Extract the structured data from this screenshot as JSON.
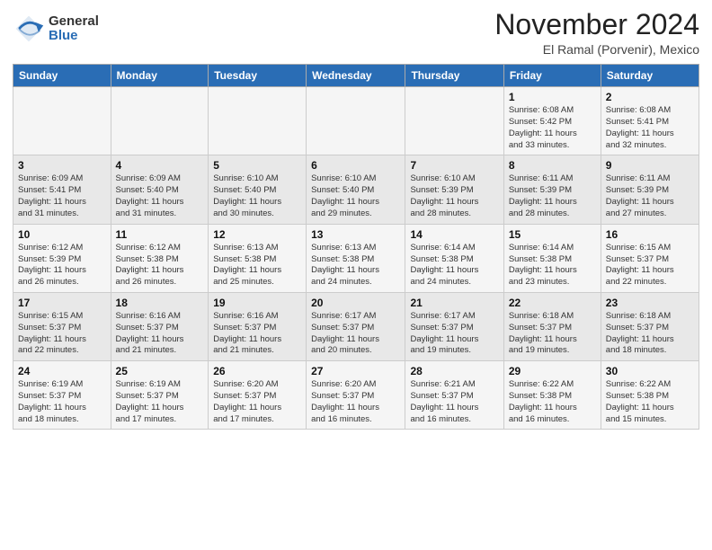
{
  "header": {
    "logo_general": "General",
    "logo_blue": "Blue",
    "month_year": "November 2024",
    "location": "El Ramal (Porvenir), Mexico"
  },
  "days_of_week": [
    "Sunday",
    "Monday",
    "Tuesday",
    "Wednesday",
    "Thursday",
    "Friday",
    "Saturday"
  ],
  "weeks": [
    [
      {
        "day": "",
        "info": ""
      },
      {
        "day": "",
        "info": ""
      },
      {
        "day": "",
        "info": ""
      },
      {
        "day": "",
        "info": ""
      },
      {
        "day": "",
        "info": ""
      },
      {
        "day": "1",
        "info": "Sunrise: 6:08 AM\nSunset: 5:42 PM\nDaylight: 11 hours\nand 33 minutes."
      },
      {
        "day": "2",
        "info": "Sunrise: 6:08 AM\nSunset: 5:41 PM\nDaylight: 11 hours\nand 32 minutes."
      }
    ],
    [
      {
        "day": "3",
        "info": "Sunrise: 6:09 AM\nSunset: 5:41 PM\nDaylight: 11 hours\nand 31 minutes."
      },
      {
        "day": "4",
        "info": "Sunrise: 6:09 AM\nSunset: 5:40 PM\nDaylight: 11 hours\nand 31 minutes."
      },
      {
        "day": "5",
        "info": "Sunrise: 6:10 AM\nSunset: 5:40 PM\nDaylight: 11 hours\nand 30 minutes."
      },
      {
        "day": "6",
        "info": "Sunrise: 6:10 AM\nSunset: 5:40 PM\nDaylight: 11 hours\nand 29 minutes."
      },
      {
        "day": "7",
        "info": "Sunrise: 6:10 AM\nSunset: 5:39 PM\nDaylight: 11 hours\nand 28 minutes."
      },
      {
        "day": "8",
        "info": "Sunrise: 6:11 AM\nSunset: 5:39 PM\nDaylight: 11 hours\nand 28 minutes."
      },
      {
        "day": "9",
        "info": "Sunrise: 6:11 AM\nSunset: 5:39 PM\nDaylight: 11 hours\nand 27 minutes."
      }
    ],
    [
      {
        "day": "10",
        "info": "Sunrise: 6:12 AM\nSunset: 5:39 PM\nDaylight: 11 hours\nand 26 minutes."
      },
      {
        "day": "11",
        "info": "Sunrise: 6:12 AM\nSunset: 5:38 PM\nDaylight: 11 hours\nand 26 minutes."
      },
      {
        "day": "12",
        "info": "Sunrise: 6:13 AM\nSunset: 5:38 PM\nDaylight: 11 hours\nand 25 minutes."
      },
      {
        "day": "13",
        "info": "Sunrise: 6:13 AM\nSunset: 5:38 PM\nDaylight: 11 hours\nand 24 minutes."
      },
      {
        "day": "14",
        "info": "Sunrise: 6:14 AM\nSunset: 5:38 PM\nDaylight: 11 hours\nand 24 minutes."
      },
      {
        "day": "15",
        "info": "Sunrise: 6:14 AM\nSunset: 5:38 PM\nDaylight: 11 hours\nand 23 minutes."
      },
      {
        "day": "16",
        "info": "Sunrise: 6:15 AM\nSunset: 5:37 PM\nDaylight: 11 hours\nand 22 minutes."
      }
    ],
    [
      {
        "day": "17",
        "info": "Sunrise: 6:15 AM\nSunset: 5:37 PM\nDaylight: 11 hours\nand 22 minutes."
      },
      {
        "day": "18",
        "info": "Sunrise: 6:16 AM\nSunset: 5:37 PM\nDaylight: 11 hours\nand 21 minutes."
      },
      {
        "day": "19",
        "info": "Sunrise: 6:16 AM\nSunset: 5:37 PM\nDaylight: 11 hours\nand 21 minutes."
      },
      {
        "day": "20",
        "info": "Sunrise: 6:17 AM\nSunset: 5:37 PM\nDaylight: 11 hours\nand 20 minutes."
      },
      {
        "day": "21",
        "info": "Sunrise: 6:17 AM\nSunset: 5:37 PM\nDaylight: 11 hours\nand 19 minutes."
      },
      {
        "day": "22",
        "info": "Sunrise: 6:18 AM\nSunset: 5:37 PM\nDaylight: 11 hours\nand 19 minutes."
      },
      {
        "day": "23",
        "info": "Sunrise: 6:18 AM\nSunset: 5:37 PM\nDaylight: 11 hours\nand 18 minutes."
      }
    ],
    [
      {
        "day": "24",
        "info": "Sunrise: 6:19 AM\nSunset: 5:37 PM\nDaylight: 11 hours\nand 18 minutes."
      },
      {
        "day": "25",
        "info": "Sunrise: 6:19 AM\nSunset: 5:37 PM\nDaylight: 11 hours\nand 17 minutes."
      },
      {
        "day": "26",
        "info": "Sunrise: 6:20 AM\nSunset: 5:37 PM\nDaylight: 11 hours\nand 17 minutes."
      },
      {
        "day": "27",
        "info": "Sunrise: 6:20 AM\nSunset: 5:37 PM\nDaylight: 11 hours\nand 16 minutes."
      },
      {
        "day": "28",
        "info": "Sunrise: 6:21 AM\nSunset: 5:37 PM\nDaylight: 11 hours\nand 16 minutes."
      },
      {
        "day": "29",
        "info": "Sunrise: 6:22 AM\nSunset: 5:38 PM\nDaylight: 11 hours\nand 16 minutes."
      },
      {
        "day": "30",
        "info": "Sunrise: 6:22 AM\nSunset: 5:38 PM\nDaylight: 11 hours\nand 15 minutes."
      }
    ]
  ]
}
